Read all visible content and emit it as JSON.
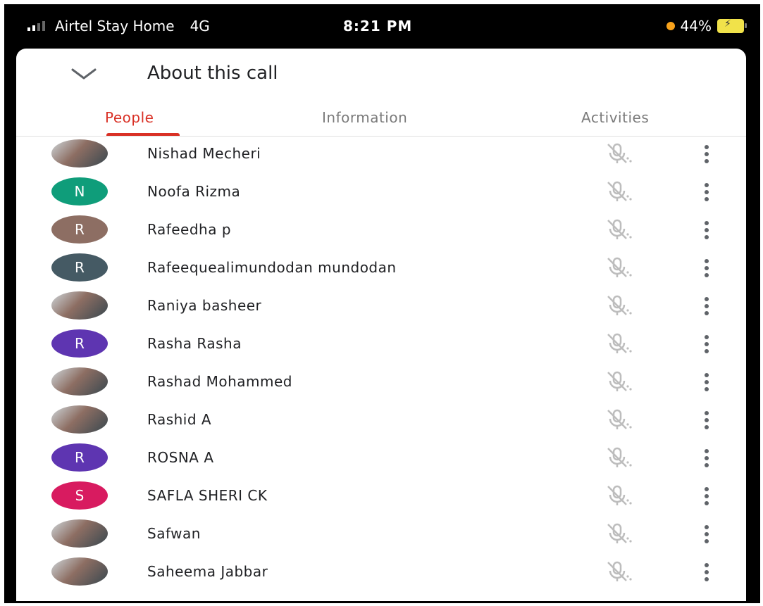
{
  "status": {
    "carrier": "Airtel Stay Home",
    "network": "4G",
    "time": "8:21 PM",
    "battery": "44%"
  },
  "header": {
    "title": "About this call"
  },
  "tabs": [
    {
      "label": "People",
      "active": true
    },
    {
      "label": "Information",
      "active": false
    },
    {
      "label": "Activities",
      "active": false
    }
  ],
  "colors": {
    "accent": "#d93025",
    "teal": "#0f9d7a",
    "brown": "#8d6e63",
    "slate": "#455a64",
    "purple": "#5e35b1",
    "pink": "#d81b60"
  },
  "participants": [
    {
      "name": "Nishad Mecheri",
      "avatar": {
        "type": "photo"
      }
    },
    {
      "name": "Noofa Rizma",
      "avatar": {
        "type": "initial",
        "initial": "N",
        "color": "#0f9d7a"
      }
    },
    {
      "name": "Rafeedha p",
      "avatar": {
        "type": "initial",
        "initial": "R",
        "color": "#8d6e63"
      }
    },
    {
      "name": "Rafeequealimundodan mundodan",
      "avatar": {
        "type": "initial",
        "initial": "R",
        "color": "#455a64"
      }
    },
    {
      "name": "Raniya basheer",
      "avatar": {
        "type": "photo"
      }
    },
    {
      "name": "Rasha Rasha",
      "avatar": {
        "type": "initial",
        "initial": "R",
        "color": "#5e35b1"
      }
    },
    {
      "name": "Rashad Mohammed",
      "avatar": {
        "type": "photo"
      }
    },
    {
      "name": "Rashid A",
      "avatar": {
        "type": "photo"
      }
    },
    {
      "name": "ROSNA A",
      "avatar": {
        "type": "initial",
        "initial": "R",
        "color": "#5e35b1"
      }
    },
    {
      "name": "SAFLA SHERI CK",
      "avatar": {
        "type": "initial",
        "initial": "S",
        "color": "#d81b60"
      }
    },
    {
      "name": "Safwan",
      "avatar": {
        "type": "photo"
      }
    },
    {
      "name": "Saheema Jabbar",
      "avatar": {
        "type": "photo"
      }
    }
  ]
}
